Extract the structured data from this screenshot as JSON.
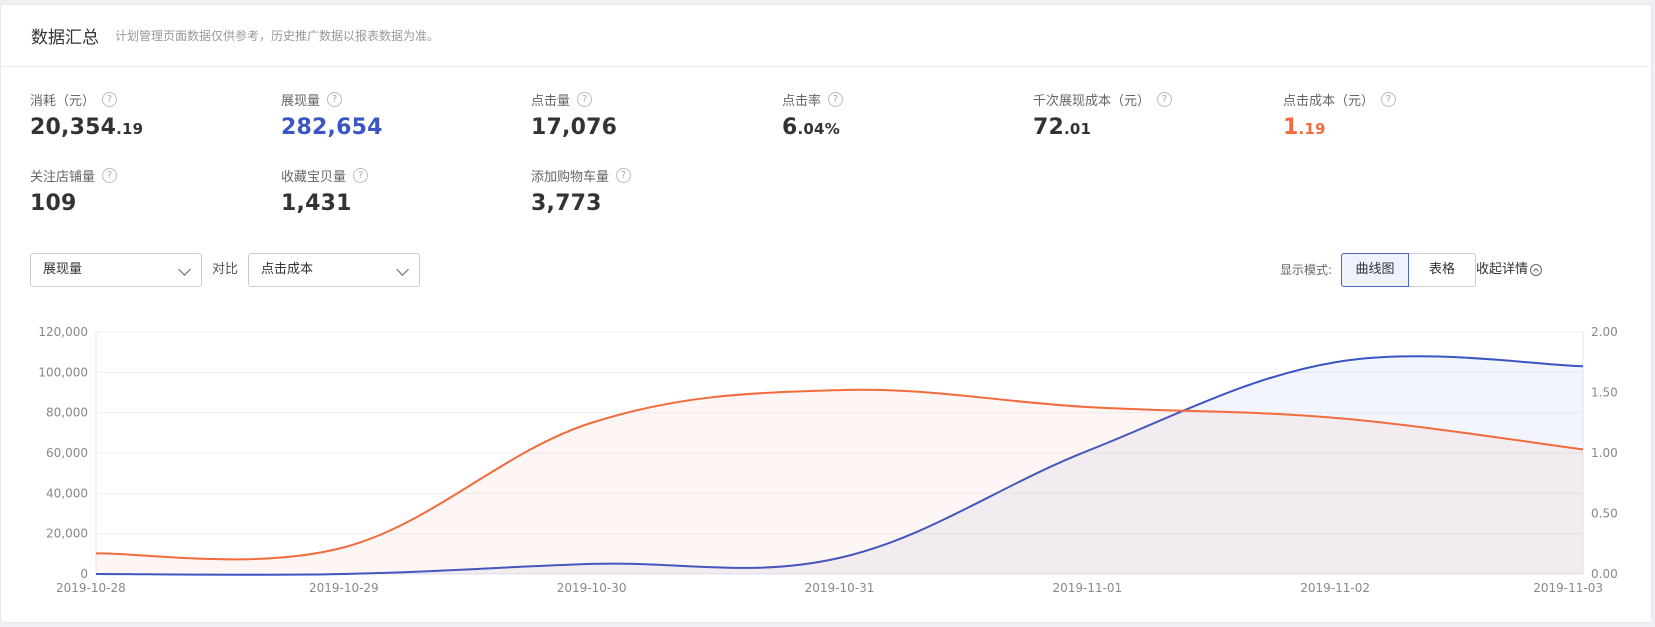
{
  "header": {
    "title": "数据汇总",
    "note": "计划管理页面数据仅供参考，历史推广数据以报表数据为准。"
  },
  "metrics": [
    {
      "label": "消耗（元）",
      "int": "20,354",
      "dec": ".19",
      "color": "default"
    },
    {
      "label": "展现量",
      "int": "282,654",
      "dec": "",
      "color": "blue"
    },
    {
      "label": "点击量",
      "int": "17,076",
      "dec": "",
      "color": "default"
    },
    {
      "label": "点击率",
      "int": "6",
      "dec": ".04%",
      "color": "default"
    },
    {
      "label": "千次展现成本（元）",
      "int": "72",
      "dec": ".01",
      "color": "default"
    },
    {
      "label": "点击成本（元）",
      "int": "1",
      "dec": ".19",
      "color": "orange"
    },
    {
      "label": "关注店铺量",
      "int": "109",
      "dec": "",
      "color": "default"
    },
    {
      "label": "收藏宝贝量",
      "int": "1,431",
      "dec": "",
      "color": "default"
    },
    {
      "label": "添加购物车量",
      "int": "3,773",
      "dec": "",
      "color": "default"
    }
  ],
  "controls": {
    "primary_select": "展现量",
    "compare_label": "对比",
    "secondary_select": "点击成本",
    "mode_label": "显示模式:",
    "mode_chart": "曲线图",
    "mode_table": "表格",
    "active_mode": "曲线图",
    "collapse_label": "收起详情"
  },
  "colors": {
    "blue": "#3b55c4",
    "orange": "#f26b3c"
  },
  "chart_data": {
    "type": "area",
    "x": [
      "2019-10-28",
      "2019-10-29",
      "2019-10-30",
      "2019-10-31",
      "2019-11-01",
      "2019-11-02",
      "2019-11-03"
    ],
    "series": [
      {
        "name": "展现量",
        "axis": "left",
        "color": "#3b55c4",
        "values": [
          0,
          0,
          5000,
          8000,
          61000,
          105000,
          103000
        ]
      },
      {
        "name": "点击成本",
        "axis": "right",
        "color": "#f26b3c",
        "values": [
          0.17,
          0.22,
          1.25,
          1.52,
          1.38,
          1.29,
          1.03
        ]
      }
    ],
    "yleft": {
      "range": [
        0,
        120000
      ],
      "ticks": [
        "0",
        "20,000",
        "40,000",
        "60,000",
        "80,000",
        "100,000",
        "120,000"
      ]
    },
    "yright": {
      "range": [
        0,
        2
      ],
      "ticks": [
        "0.00",
        "0.50",
        "1.00",
        "1.50",
        "2.00"
      ]
    },
    "grid": true
  }
}
